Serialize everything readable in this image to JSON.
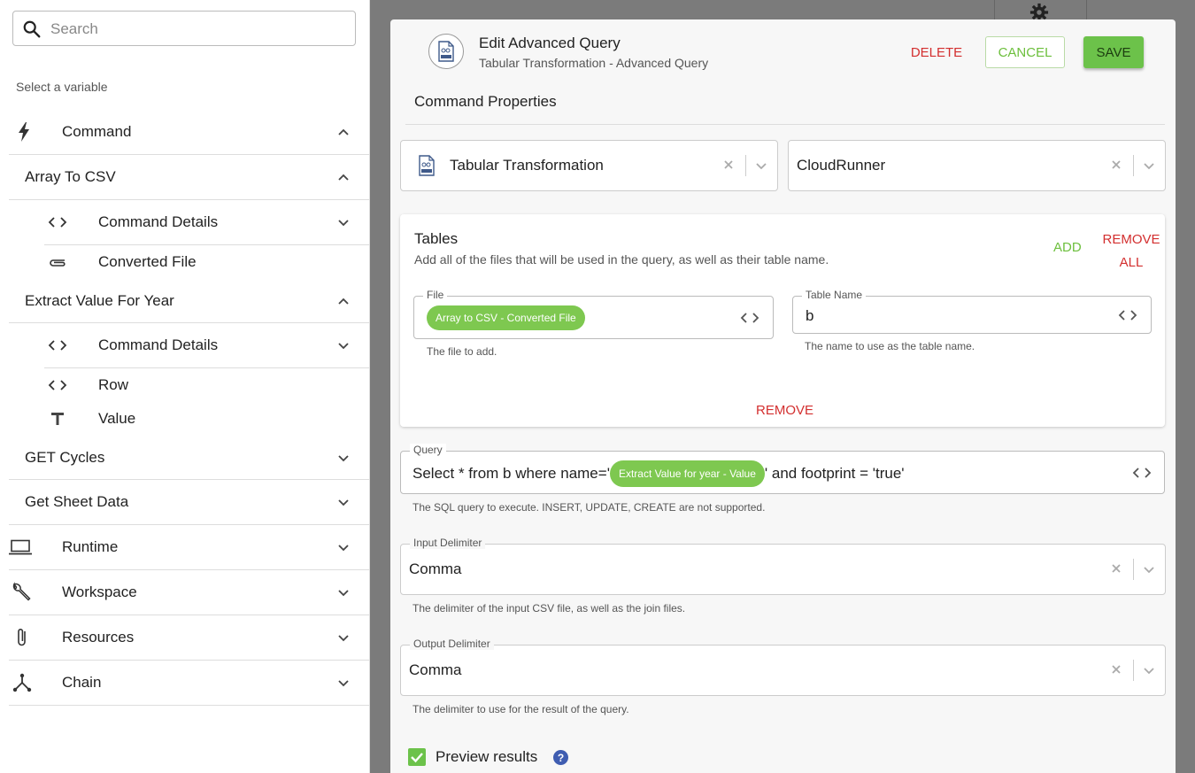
{
  "search": {
    "placeholder": "Search"
  },
  "sidebar": {
    "hint": "Select a variable",
    "items": [
      {
        "label": "Command",
        "icon": "lightning-icon",
        "expanded": true
      },
      {
        "label": "Array To CSV",
        "expanded": true
      },
      {
        "label": "Command Details",
        "icon": "code-icon"
      },
      {
        "label": "Converted File",
        "icon": "paperclip-icon"
      },
      {
        "label": "Extract Value For Year",
        "expanded": true
      },
      {
        "label": "Command Details",
        "icon": "code-icon"
      },
      {
        "label": "Row",
        "icon": "code-icon"
      },
      {
        "label": "Value",
        "icon": "text-icon"
      },
      {
        "label": "GET Cycles"
      },
      {
        "label": "Get Sheet Data"
      },
      {
        "label": "Runtime",
        "icon": "laptop-icon"
      },
      {
        "label": "Workspace",
        "icon": "wrench-icon"
      },
      {
        "label": "Resources",
        "icon": "paperclip-icon"
      },
      {
        "label": "Chain",
        "icon": "chain-icon"
      }
    ]
  },
  "modal": {
    "title": "Edit Advanced Query",
    "subtitle": "Tabular Transformation - Advanced Query",
    "delete_label": "DELETE",
    "cancel_label": "CANCEL",
    "save_label": "SAVE",
    "section_title": "Command Properties",
    "command_select": {
      "value": "Tabular Transformation"
    },
    "runner_select": {
      "value": "CloudRunner"
    },
    "tables": {
      "title": "Tables",
      "subtitle": "Add all of the files that will be used in the query, as well as their table name.",
      "add_label": "ADD",
      "remove_all_line1": "REMOVE",
      "remove_all_line2": "ALL",
      "file_label": "File",
      "file_chip": "Array to CSV - Converted File",
      "file_help": "The file to add.",
      "table_name_label": "Table Name",
      "table_name_value": "b",
      "table_name_help": "The name to use as the table name.",
      "remove_label": "REMOVE"
    },
    "query": {
      "label": "Query",
      "prefix": "Select * from b where name='",
      "chip": "Extract Value for year - Value",
      "suffix": "' and footprint = 'true'",
      "help": "The SQL query to execute. INSERT, UPDATE, CREATE are not supported."
    },
    "input_delimiter": {
      "label": "Input Delimiter",
      "value": "Comma",
      "help": "The delimiter of the input CSV file, as well as the join files."
    },
    "output_delimiter": {
      "label": "Output Delimiter",
      "value": "Comma",
      "help": "The delimiter to use for the result of the query."
    },
    "preview": {
      "label": "Preview results",
      "checked": true,
      "help_icon": "?"
    }
  },
  "colors": {
    "accent_green": "#6cc24a",
    "danger_red": "#d32f2f",
    "chip_green": "#7ec850"
  }
}
